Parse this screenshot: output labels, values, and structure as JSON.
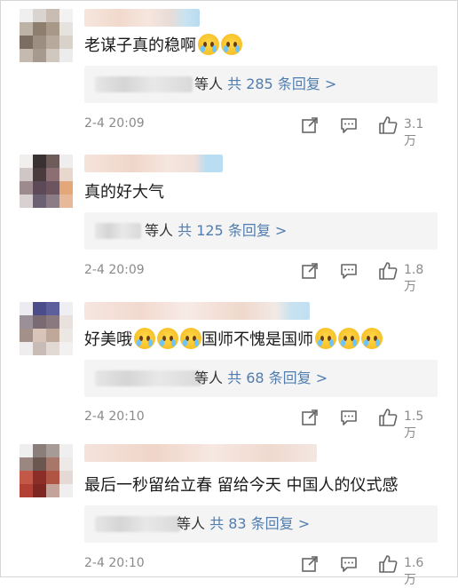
{
  "comments": [
    {
      "text": "老谋子真的稳啊",
      "emoji_count": 2,
      "reply_tail": "等人",
      "reply_link": "共 285 条回复 >",
      "time": "2-4 20:09",
      "likes": "3.1万"
    },
    {
      "text": "真的好大气",
      "emoji_count": 0,
      "reply_tail": "等人",
      "reply_link": "共 125 条回复 >",
      "time": "2-4 20:09",
      "likes": "1.8万"
    },
    {
      "text_before": "好美哦",
      "text_after": "国师不愧是国师",
      "reply_tail": "等人",
      "reply_link": "共 68 条回复 >",
      "time": "2-4 20:10",
      "likes": "1.5万"
    },
    {
      "text": "最后一秒留给立春 留给今天 中国人的仪式感",
      "emoji_count": 0,
      "reply_tail": "等人",
      "reply_link": "共 83 条回复 >",
      "time": "2-4 20:10",
      "likes": "1.6万"
    }
  ],
  "icons": {
    "repost": "share-icon",
    "comment": "comment-icon",
    "like": "thumbs-up-icon",
    "emoji": "crying-face-emoji"
  },
  "colors": {
    "link": "#507daf",
    "meta": "#8a8a8a",
    "reply_bg": "#f4f4f4"
  }
}
